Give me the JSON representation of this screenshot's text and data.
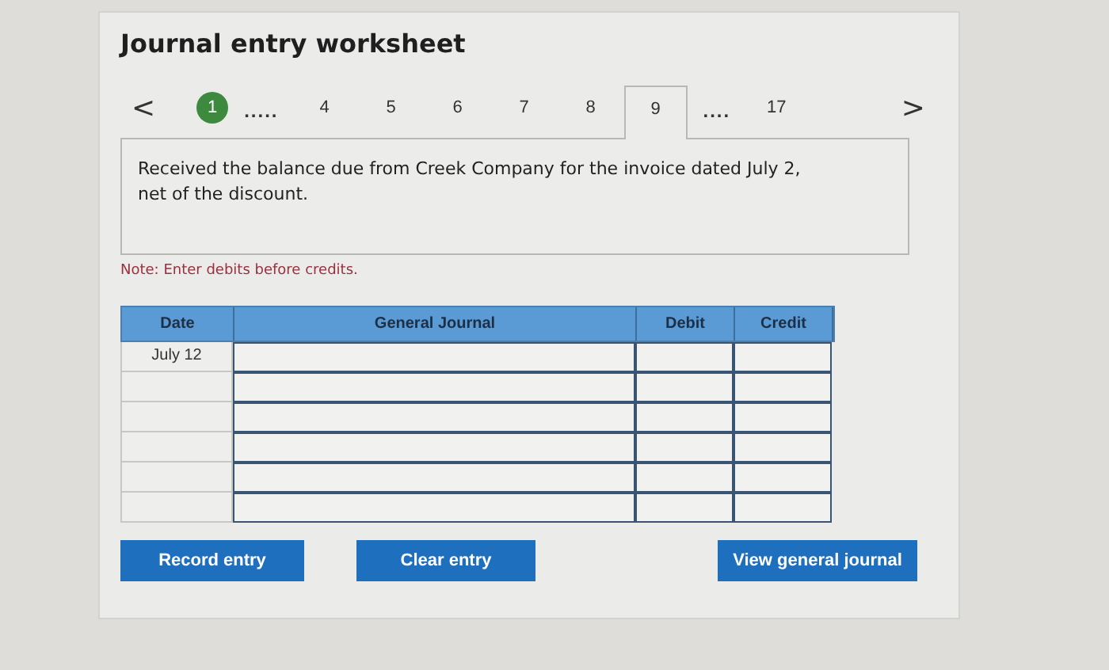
{
  "title": "Journal entry worksheet",
  "nav": {
    "prev": "<",
    "next": ">",
    "steps": [
      {
        "kind": "step",
        "label": "1",
        "done": true,
        "selected": false
      },
      {
        "kind": "ellipsis",
        "label": "....."
      },
      {
        "kind": "step",
        "label": "4",
        "done": false,
        "selected": false
      },
      {
        "kind": "step",
        "label": "5",
        "done": false,
        "selected": false
      },
      {
        "kind": "step",
        "label": "6",
        "done": false,
        "selected": false
      },
      {
        "kind": "step",
        "label": "7",
        "done": false,
        "selected": false
      },
      {
        "kind": "step",
        "label": "8",
        "done": false,
        "selected": false
      },
      {
        "kind": "step",
        "label": "9",
        "done": false,
        "selected": true
      },
      {
        "kind": "ellipsis",
        "label": "...."
      },
      {
        "kind": "step",
        "label": "17",
        "done": false,
        "selected": false
      }
    ]
  },
  "description": "Received the balance due from Creek Company for the invoice dated July 2, net of the discount.",
  "note": "Note: Enter debits before credits.",
  "table": {
    "columns": [
      "Date",
      "General Journal",
      "Debit",
      "Credit"
    ],
    "rows": [
      {
        "date": "July 12"
      },
      {},
      {},
      {},
      {},
      {}
    ]
  },
  "buttons": [
    "Record entry",
    "Clear entry",
    "View general journal"
  ]
}
